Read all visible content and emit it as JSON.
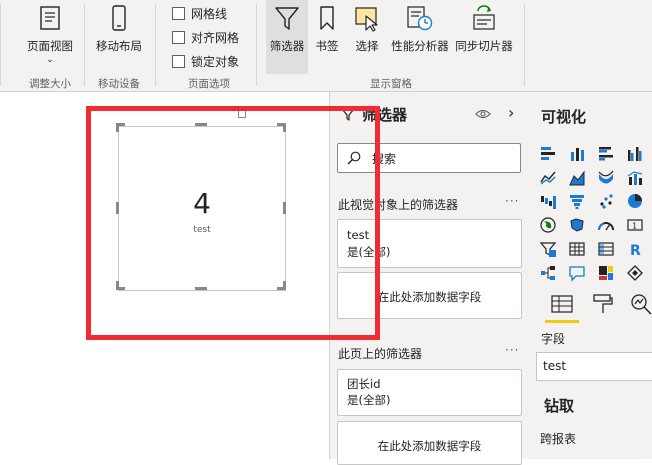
{
  "ribbon": {
    "groups": [
      {
        "label": "调整大小",
        "buttons": [
          {
            "label": "页面视图"
          }
        ]
      },
      {
        "label": "移动设备",
        "buttons": [
          {
            "label": "移动布局"
          }
        ]
      },
      {
        "label": "页面选项",
        "checkboxes": [
          {
            "label": "网格线"
          },
          {
            "label": "对齐网格"
          },
          {
            "label": "锁定对象"
          }
        ]
      },
      {
        "label": "显示窗格",
        "buttons": [
          {
            "label": "筛选器"
          },
          {
            "label": "书签"
          },
          {
            "label": "选择"
          },
          {
            "label": "性能分析器"
          },
          {
            "label": "同步切片器"
          }
        ]
      }
    ]
  },
  "canvas": {
    "card_value": "4",
    "card_label": "test"
  },
  "filters": {
    "title": "筛选器",
    "search_placeholder": "搜索",
    "visual_section_title": "此视觉对象上的筛选器",
    "visual_filter": {
      "field": "test",
      "state": "是(全部)"
    },
    "add_field_label": "在此处添加数据字段",
    "page_section_title": "此页上的筛选器",
    "page_filter": {
      "field": "团长id",
      "state": "是(全部)"
    },
    "add_field_label_page": "在此处添加数据字段"
  },
  "visualizations": {
    "title": "可视化",
    "fields_label": "字段",
    "field_value": "test",
    "drill_title": "钻取",
    "cross_report_label": "跨报表"
  },
  "colors": {
    "accent": "#f2c811",
    "highlight_border": "#ef2b33"
  }
}
